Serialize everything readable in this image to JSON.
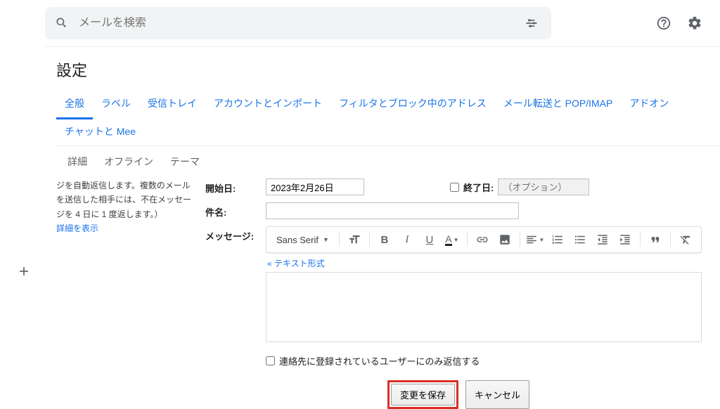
{
  "search": {
    "placeholder": "メールを検索"
  },
  "page": {
    "title": "設定"
  },
  "tabs": {
    "row1": [
      "全般",
      "ラベル",
      "受信トレイ",
      "アカウントとインポート",
      "フィルタとブロック中のアドレス",
      "メール転送と POP/IMAP",
      "アドオン",
      "チャットと Mee"
    ],
    "row2": [
      "詳細",
      "オフライン",
      "テーマ"
    ],
    "active_index": 0
  },
  "vacation": {
    "desc_fragment": "ジを自動返信します。複数のメールを送信した相手には、不在メッセージを 4 日に 1 度返します。）",
    "show_more": "詳細を表示",
    "labels": {
      "start": "開始日:",
      "end": "終了日:",
      "end_opt": "（オプション）",
      "subject": "件名:",
      "message": "メッセージ:"
    },
    "start_date": "2023年2月26日",
    "font_name": "Sans Serif",
    "plain_text_link": "« テキスト形式",
    "contacts_only": "連絡先に登録されているユーザーにのみ返信する"
  },
  "buttons": {
    "save": "変更を保存",
    "cancel": "キャンセル"
  }
}
